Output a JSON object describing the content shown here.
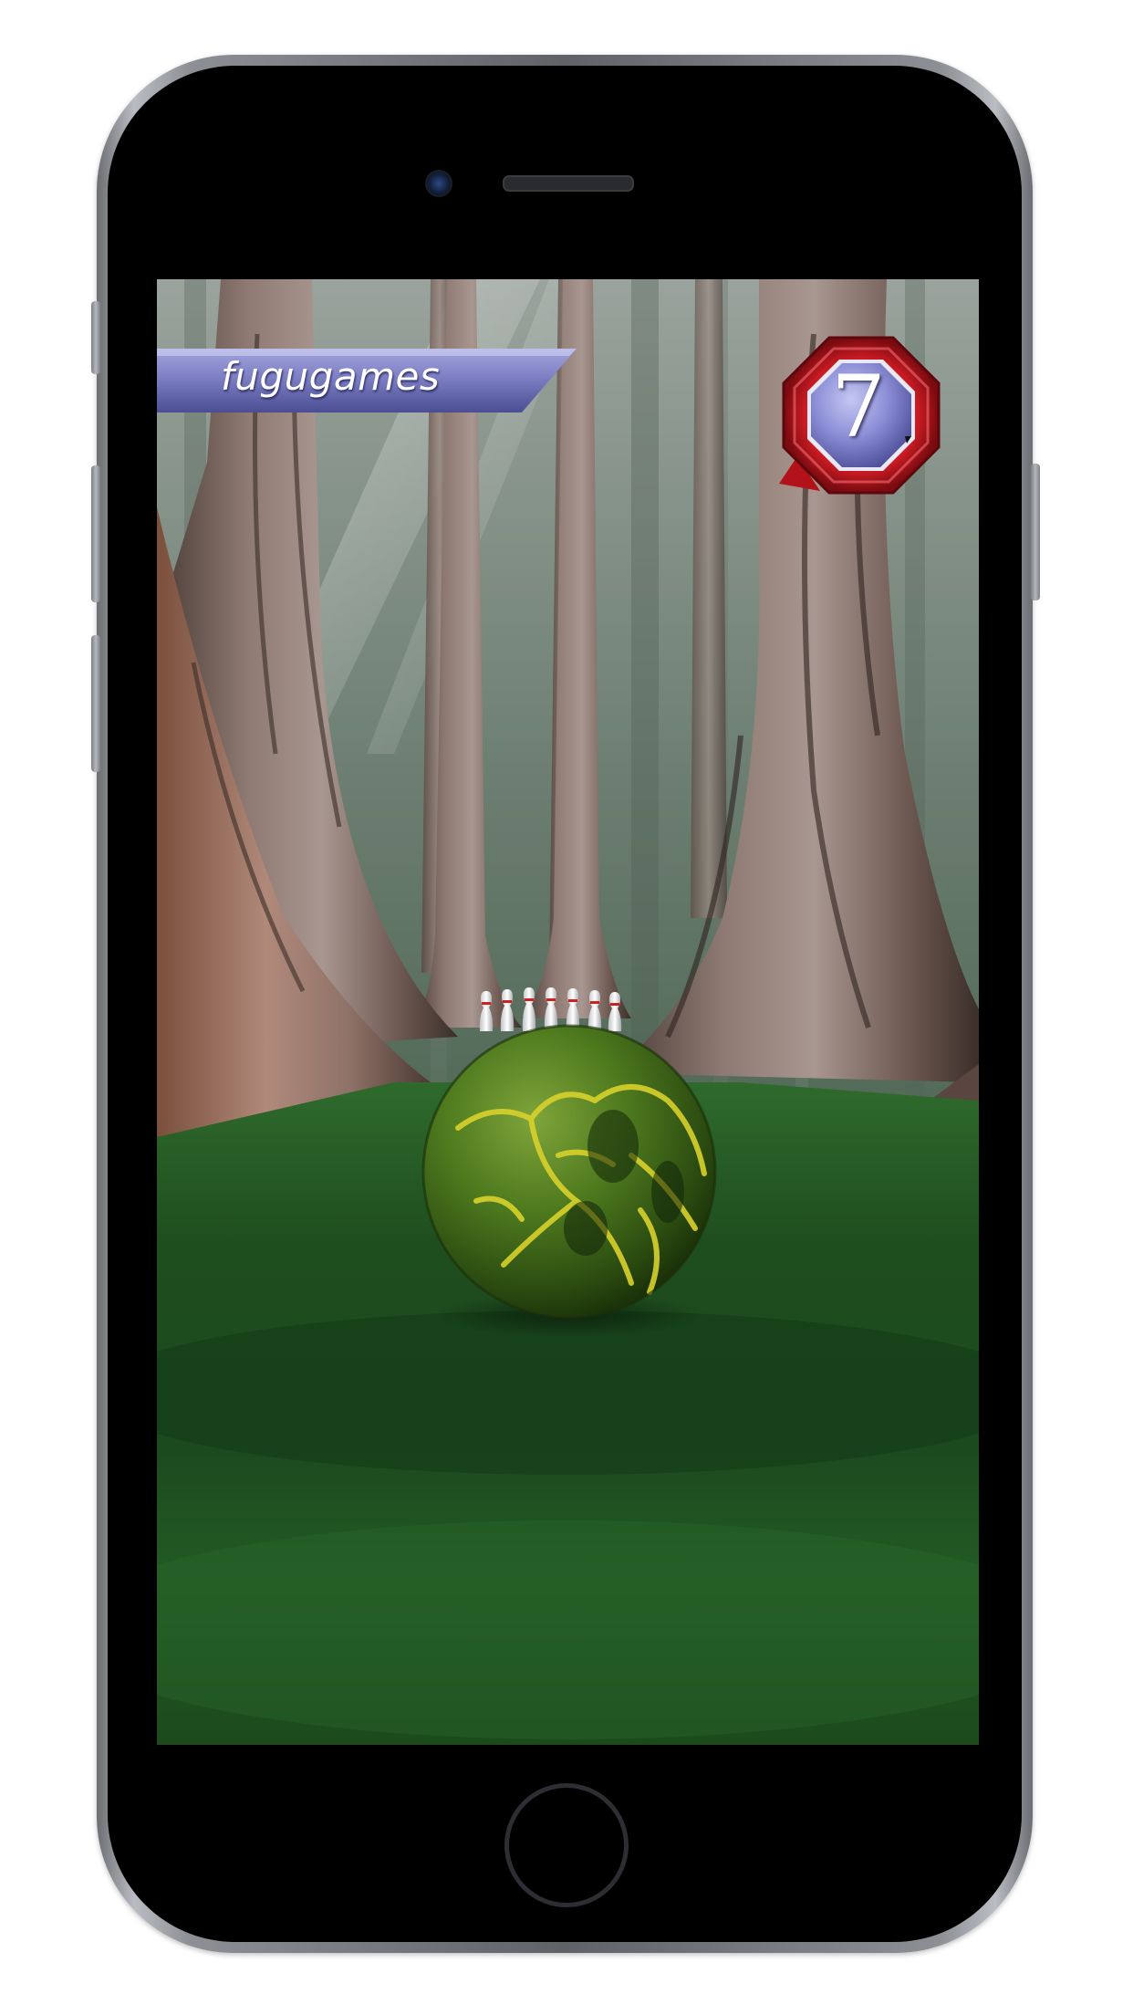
{
  "hud": {
    "player_name": "fugugames",
    "frame_number": "7"
  },
  "colors": {
    "banner": "#7d7fc4",
    "badge_ring": "#b3121b",
    "badge_center": "#8e90d8",
    "lane": "#1f5a22",
    "ball": "#3f6b1a",
    "ball_veins": "#d9d12c"
  },
  "icons": {
    "ball": "bowling-ball-icon",
    "pins": "bowling-pins-icon"
  }
}
